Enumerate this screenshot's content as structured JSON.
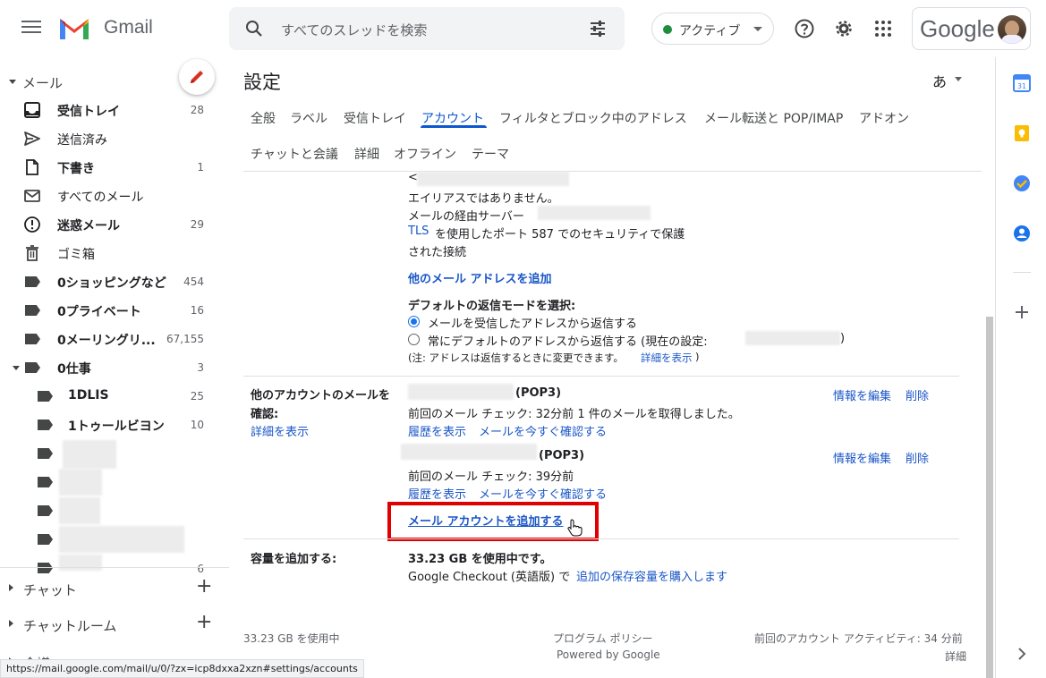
{
  "header": {
    "app_name": "Gmail",
    "search_placeholder": "すべてのスレッドを検索",
    "status_label": "アクティブ",
    "account_logo_text": "Google"
  },
  "sidebar": {
    "mail_section": "メール",
    "items": [
      {
        "label": "受信トレイ",
        "count": "28",
        "bold": true
      },
      {
        "label": "送信済み",
        "count": "",
        "bold": false
      },
      {
        "label": "下書き",
        "count": "1",
        "bold": true
      },
      {
        "label": "すべてのメール",
        "count": "",
        "bold": false
      },
      {
        "label": "迷惑メール",
        "count": "29",
        "bold": true
      },
      {
        "label": "ゴミ箱",
        "count": "",
        "bold": false
      }
    ],
    "labels": [
      {
        "label": "0ショッピングなど",
        "count": "454"
      },
      {
        "label": "0プライベート",
        "count": "16"
      },
      {
        "label": "0メーリングリ...",
        "count": "67,155"
      },
      {
        "label": "0仕事",
        "count": "3"
      },
      {
        "label": "1DLIS",
        "count": "25"
      },
      {
        "label": "1トゥールビヨン",
        "count": "10"
      }
    ],
    "partial_count": "6",
    "chat": "チャット",
    "chat_rooms": "チャットルーム",
    "meeting_partial": "会議"
  },
  "main": {
    "title": "設定",
    "language": "あ",
    "tabs": [
      "全般",
      "ラベル",
      "受信トレイ",
      "アカウント",
      "フィルタとブロック中のアドレス",
      "メール転送と POP/IMAP",
      "アドオン",
      "チャットと会議",
      "詳細",
      "オフライン",
      "テーマ"
    ],
    "active_tab": "アカウント",
    "send_as": {
      "lt": "<",
      "not_alias": "エイリアスではありません。",
      "via_server": "メールの経由サーバー",
      "tls_link": "TLS",
      "tls_text": "を使用したポート 587 でのセキュリティで保護",
      "tls_text2": "された接続",
      "add_other": "他のメール アドレスを追加",
      "reply_mode_title": "デフォルトの返信モードを選択:",
      "reply_option1": "メールを受信したアドレスから返信する",
      "reply_option2": "常にデフォルトのアドレスから返信する (現在の設定:",
      "reply_option2_end": ")",
      "note": "(注: アドレスは返信するときに変更できます。",
      "note_link": "詳細を表示",
      "note_end": ")"
    },
    "check_mail": {
      "label1": "他のアカウントのメールを",
      "label2": "確認:",
      "learn_more": "詳細を表示",
      "account1_proto": "(POP3)",
      "account1_status": "前回のメール チェック: 32分前 1 件のメールを取得しました。",
      "account2_proto": "(POP3)",
      "account2_status": "前回のメール チェック: 39分前",
      "view_history": "履歴を表示",
      "check_now": "メールを今すぐ確認する",
      "edit_info": "情報を編集",
      "delete": "削除",
      "add_account": "メール アカウントを追加する"
    },
    "storage": {
      "label": "容量を追加する:",
      "usage": "33.23 GB を使用中です。",
      "checkout_text": "Google Checkout (英語版) で",
      "buy_link": "追加の保存容量を購入します"
    },
    "footer": {
      "usage": "33.23 GB を使用中",
      "policy": "プログラム ポリシー",
      "powered": "Powered by Google",
      "activity": "前回のアカウント アクティビティ: 34 分前",
      "details": "詳細"
    }
  },
  "status_url": "https://mail.google.com/mail/u/0/?zx=icp8dxxa2xzn#settings/accounts",
  "colors": {
    "accent": "#0b57d0",
    "link": "#1a56c7",
    "highlight_box": "#e00000",
    "status_active": "#1e8e3e"
  }
}
